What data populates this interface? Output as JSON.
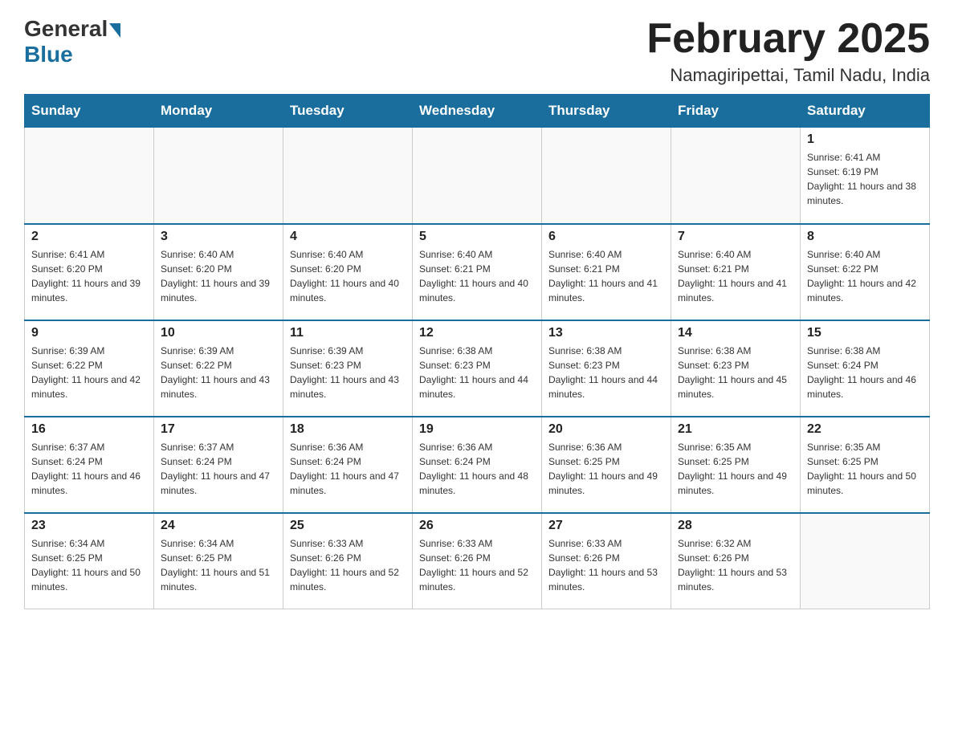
{
  "logo": {
    "general": "General",
    "blue": "Blue"
  },
  "header": {
    "month_year": "February 2025",
    "location": "Namagiripettai, Tamil Nadu, India"
  },
  "weekdays": [
    "Sunday",
    "Monday",
    "Tuesday",
    "Wednesday",
    "Thursday",
    "Friday",
    "Saturday"
  ],
  "weeks": [
    [
      {
        "day": "",
        "info": ""
      },
      {
        "day": "",
        "info": ""
      },
      {
        "day": "",
        "info": ""
      },
      {
        "day": "",
        "info": ""
      },
      {
        "day": "",
        "info": ""
      },
      {
        "day": "",
        "info": ""
      },
      {
        "day": "1",
        "info": "Sunrise: 6:41 AM\nSunset: 6:19 PM\nDaylight: 11 hours and 38 minutes."
      }
    ],
    [
      {
        "day": "2",
        "info": "Sunrise: 6:41 AM\nSunset: 6:20 PM\nDaylight: 11 hours and 39 minutes."
      },
      {
        "day": "3",
        "info": "Sunrise: 6:40 AM\nSunset: 6:20 PM\nDaylight: 11 hours and 39 minutes."
      },
      {
        "day": "4",
        "info": "Sunrise: 6:40 AM\nSunset: 6:20 PM\nDaylight: 11 hours and 40 minutes."
      },
      {
        "day": "5",
        "info": "Sunrise: 6:40 AM\nSunset: 6:21 PM\nDaylight: 11 hours and 40 minutes."
      },
      {
        "day": "6",
        "info": "Sunrise: 6:40 AM\nSunset: 6:21 PM\nDaylight: 11 hours and 41 minutes."
      },
      {
        "day": "7",
        "info": "Sunrise: 6:40 AM\nSunset: 6:21 PM\nDaylight: 11 hours and 41 minutes."
      },
      {
        "day": "8",
        "info": "Sunrise: 6:40 AM\nSunset: 6:22 PM\nDaylight: 11 hours and 42 minutes."
      }
    ],
    [
      {
        "day": "9",
        "info": "Sunrise: 6:39 AM\nSunset: 6:22 PM\nDaylight: 11 hours and 42 minutes."
      },
      {
        "day": "10",
        "info": "Sunrise: 6:39 AM\nSunset: 6:22 PM\nDaylight: 11 hours and 43 minutes."
      },
      {
        "day": "11",
        "info": "Sunrise: 6:39 AM\nSunset: 6:23 PM\nDaylight: 11 hours and 43 minutes."
      },
      {
        "day": "12",
        "info": "Sunrise: 6:38 AM\nSunset: 6:23 PM\nDaylight: 11 hours and 44 minutes."
      },
      {
        "day": "13",
        "info": "Sunrise: 6:38 AM\nSunset: 6:23 PM\nDaylight: 11 hours and 44 minutes."
      },
      {
        "day": "14",
        "info": "Sunrise: 6:38 AM\nSunset: 6:23 PM\nDaylight: 11 hours and 45 minutes."
      },
      {
        "day": "15",
        "info": "Sunrise: 6:38 AM\nSunset: 6:24 PM\nDaylight: 11 hours and 46 minutes."
      }
    ],
    [
      {
        "day": "16",
        "info": "Sunrise: 6:37 AM\nSunset: 6:24 PM\nDaylight: 11 hours and 46 minutes."
      },
      {
        "day": "17",
        "info": "Sunrise: 6:37 AM\nSunset: 6:24 PM\nDaylight: 11 hours and 47 minutes."
      },
      {
        "day": "18",
        "info": "Sunrise: 6:36 AM\nSunset: 6:24 PM\nDaylight: 11 hours and 47 minutes."
      },
      {
        "day": "19",
        "info": "Sunrise: 6:36 AM\nSunset: 6:24 PM\nDaylight: 11 hours and 48 minutes."
      },
      {
        "day": "20",
        "info": "Sunrise: 6:36 AM\nSunset: 6:25 PM\nDaylight: 11 hours and 49 minutes."
      },
      {
        "day": "21",
        "info": "Sunrise: 6:35 AM\nSunset: 6:25 PM\nDaylight: 11 hours and 49 minutes."
      },
      {
        "day": "22",
        "info": "Sunrise: 6:35 AM\nSunset: 6:25 PM\nDaylight: 11 hours and 50 minutes."
      }
    ],
    [
      {
        "day": "23",
        "info": "Sunrise: 6:34 AM\nSunset: 6:25 PM\nDaylight: 11 hours and 50 minutes."
      },
      {
        "day": "24",
        "info": "Sunrise: 6:34 AM\nSunset: 6:25 PM\nDaylight: 11 hours and 51 minutes."
      },
      {
        "day": "25",
        "info": "Sunrise: 6:33 AM\nSunset: 6:26 PM\nDaylight: 11 hours and 52 minutes."
      },
      {
        "day": "26",
        "info": "Sunrise: 6:33 AM\nSunset: 6:26 PM\nDaylight: 11 hours and 52 minutes."
      },
      {
        "day": "27",
        "info": "Sunrise: 6:33 AM\nSunset: 6:26 PM\nDaylight: 11 hours and 53 minutes."
      },
      {
        "day": "28",
        "info": "Sunrise: 6:32 AM\nSunset: 6:26 PM\nDaylight: 11 hours and 53 minutes."
      },
      {
        "day": "",
        "info": ""
      }
    ]
  ]
}
